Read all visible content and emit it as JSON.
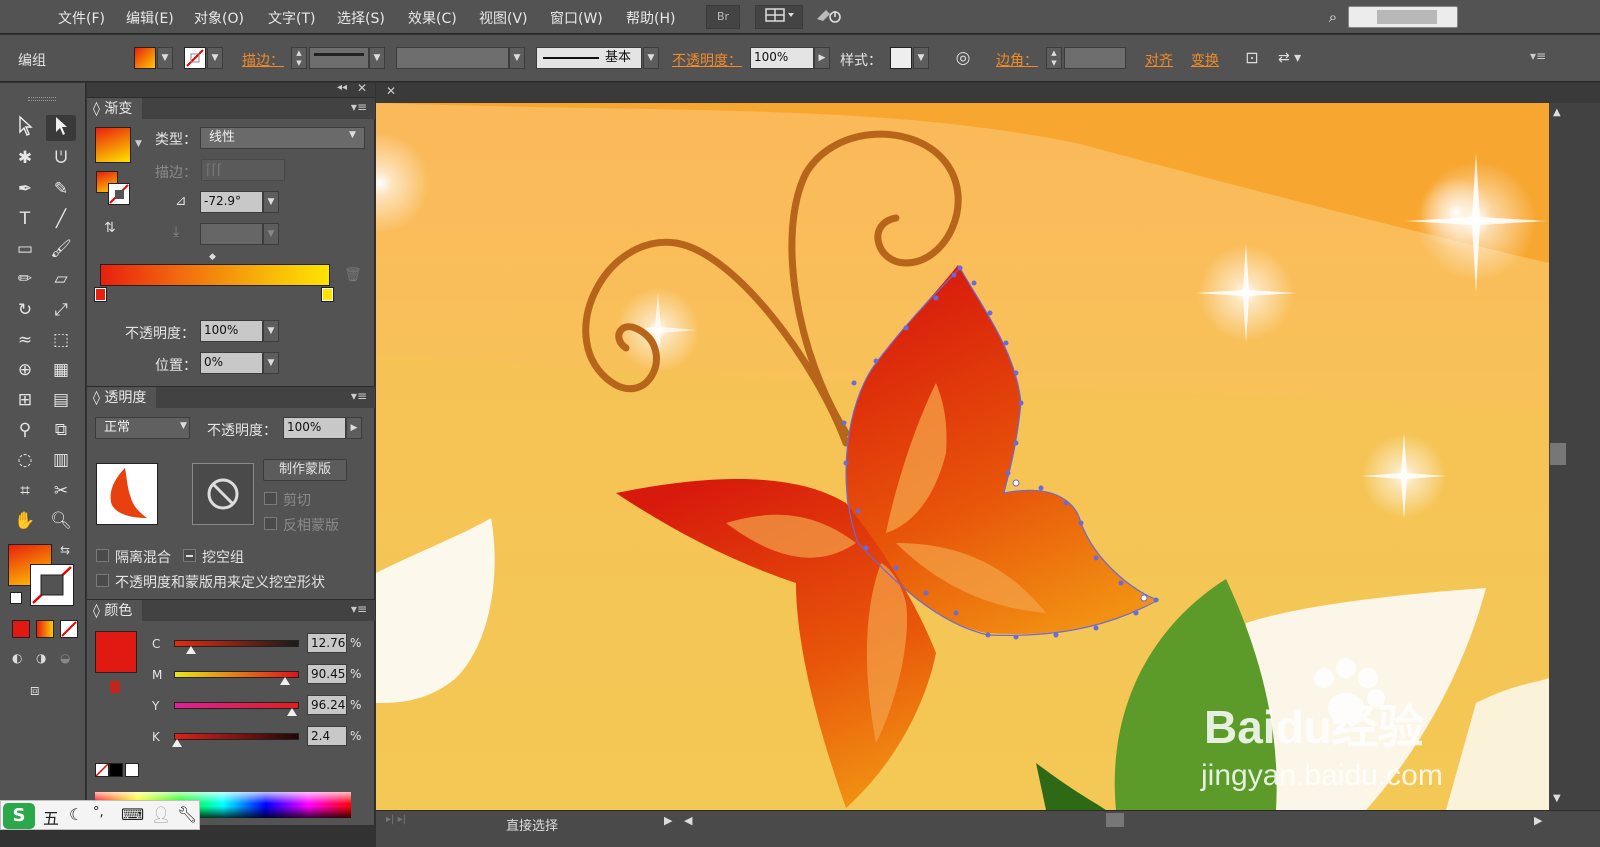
{
  "menubar": {
    "items": [
      "文件(F)",
      "编辑(E)",
      "对象(O)",
      "文字(T)",
      "选择(S)",
      "效果(C)",
      "视图(V)",
      "窗口(W)",
      "帮助(H)"
    ],
    "bridge_label": "Br"
  },
  "control_bar": {
    "selection_label": "编组",
    "stroke_label": "描边：",
    "stroke_style_label": "基本",
    "opacity_label": "不透明度：",
    "opacity_value": "100%",
    "style_label": "样式：",
    "corner_label": "边角：",
    "align_label": "对齐",
    "transform_label": "变换"
  },
  "gradient_panel": {
    "title": "渐变",
    "type_label": "类型：",
    "type_value": "线性",
    "stroke_label": "描边：",
    "angle_value": "-72.9°",
    "opacity_label": "不透明度：",
    "opacity_value": "100%",
    "location_label": "位置：",
    "location_value": "0%"
  },
  "transparency_panel": {
    "title": "透明度",
    "blend_mode": "正常",
    "opacity_label": "不透明度：",
    "opacity_value": "100%",
    "make_mask_label": "制作蒙版",
    "clip_label": "剪切",
    "invert_mask_label": "反相蒙版",
    "isolate_label": "隔离混合",
    "knockout_label": "挖空组",
    "opacity_mask_label": "不透明度和蒙版用来定义挖空形状"
  },
  "color_panel": {
    "title": "颜色",
    "channels": [
      {
        "name": "C",
        "value": "12.76",
        "fraction": 0.13
      },
      {
        "name": "M",
        "value": "90.45",
        "fraction": 0.9
      },
      {
        "name": "Y",
        "value": "96.24",
        "fraction": 0.96
      },
      {
        "name": "K",
        "value": "2.4",
        "fraction": 0.02
      }
    ],
    "percent": "%"
  },
  "status_bar": {
    "tool_label": "直接选择"
  },
  "watermark": {
    "brand": "Baidu经验",
    "url": "jingyan.baidu.com"
  },
  "ime": {
    "mode": "五"
  },
  "colors": {
    "fill_orange": "#f08a2a",
    "selected_red": "#e01a12",
    "gradient_start": "#e8200e",
    "gradient_end": "#ffe400",
    "ui_dark": "#535353"
  }
}
